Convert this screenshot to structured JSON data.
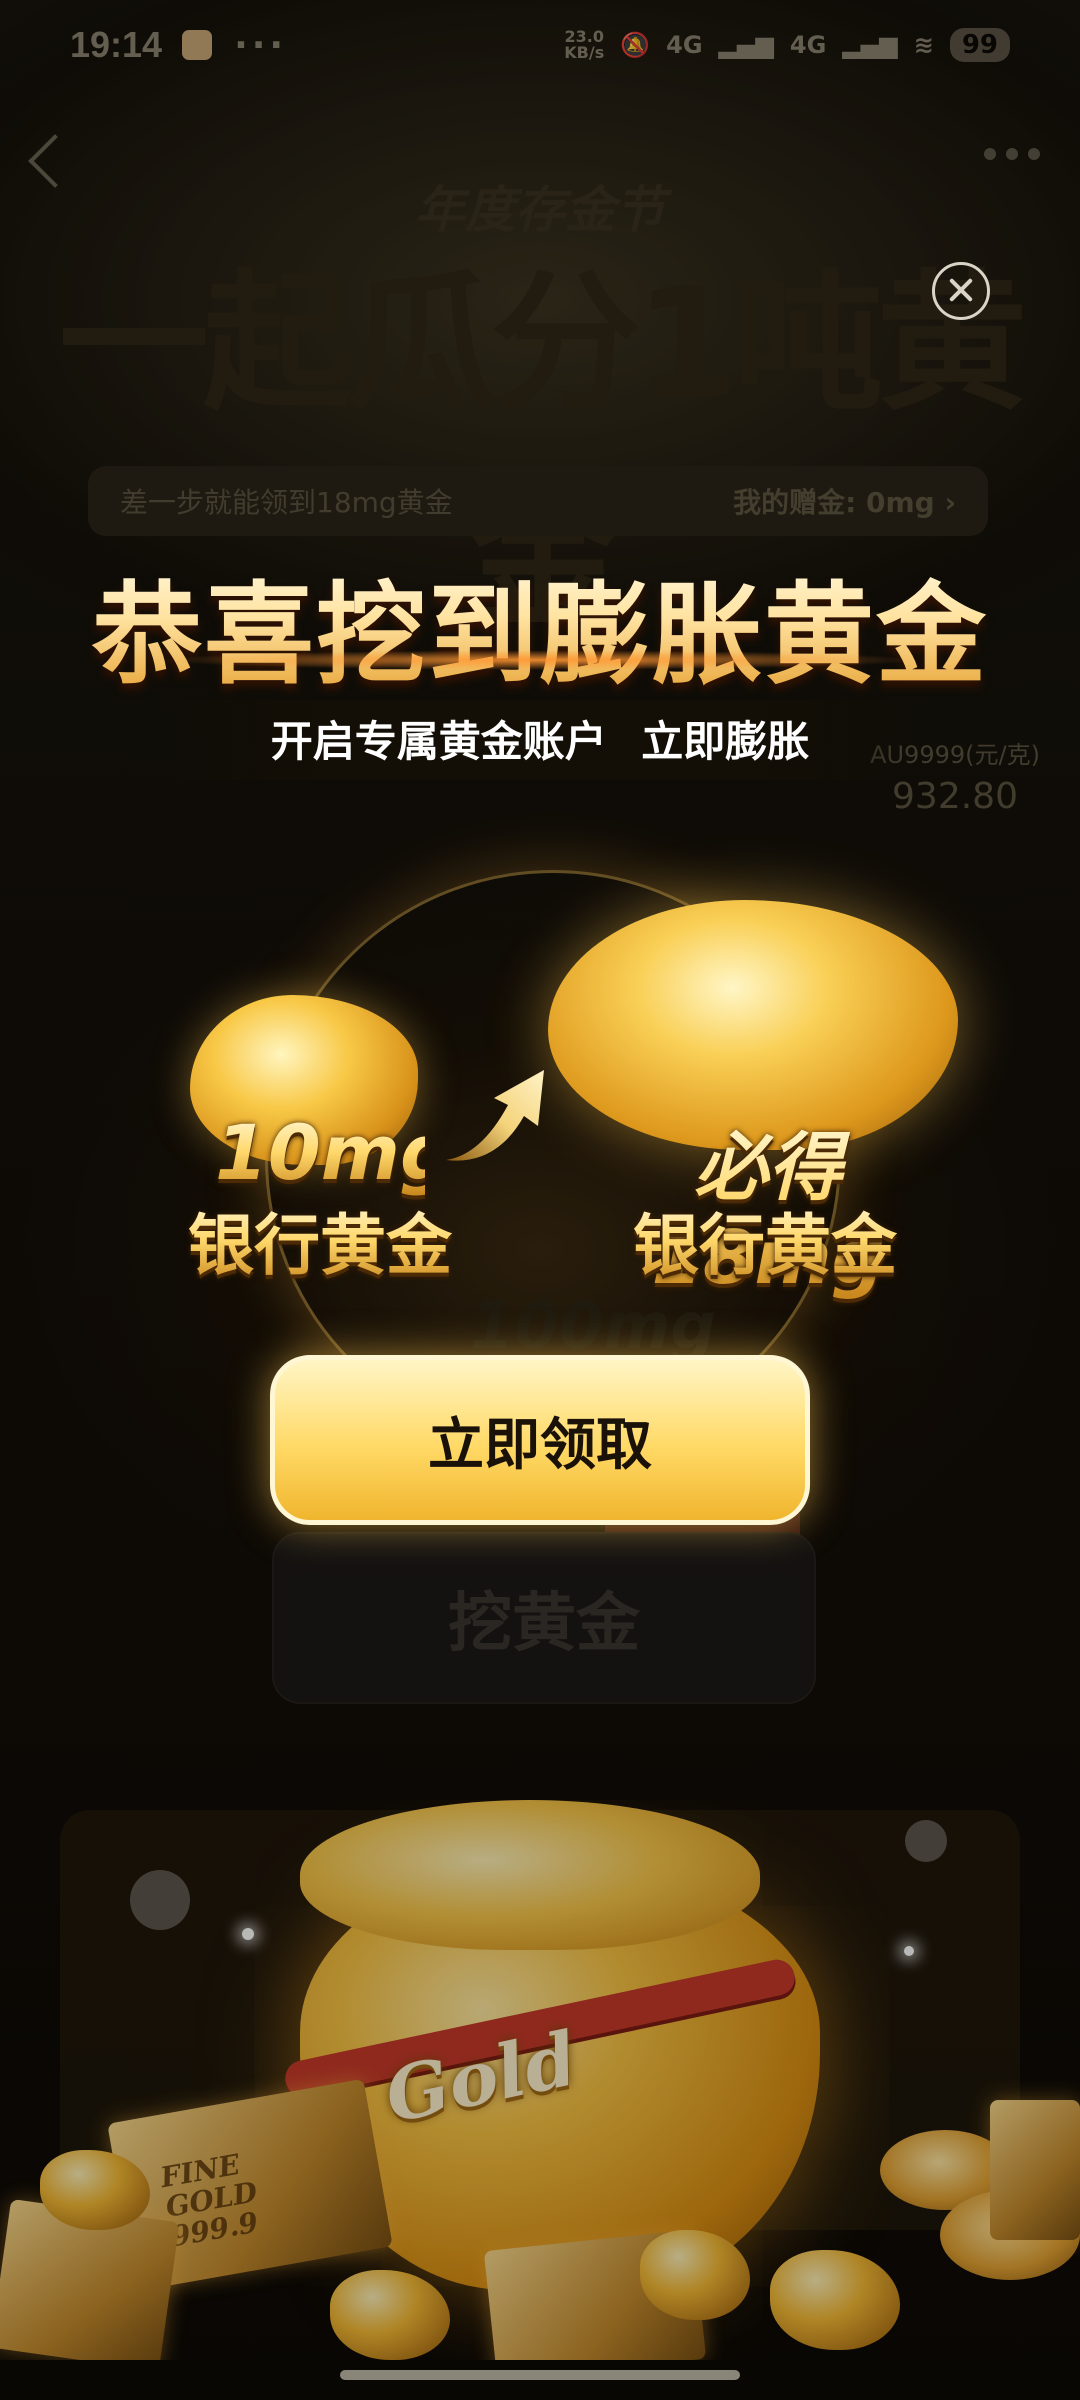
{
  "status_bar": {
    "time": "19:14",
    "more": "···",
    "net_speed_value": "23.0",
    "net_speed_unit": "KB/s",
    "signal_1": "4G",
    "signal_2": "4G",
    "battery": "99"
  },
  "background_page": {
    "subtitle": "年度存金节",
    "headline": "一起瓜分1吨黄金",
    "progress_text": "差一步就能领到18mg黄金",
    "my_gift": "我的赠金: 0mg ›",
    "price_label": "AU9999(元/克)",
    "price_value": "932.80",
    "mid_amount": "100mg",
    "dig_button": "挖黄金"
  },
  "popup": {
    "title": "恭喜挖到膨胀黄金",
    "subtitle": "开启专属黄金账户   立即膨胀",
    "small_reward_amount": "10mg",
    "small_reward_label": "银行黄金",
    "large_reward_amount": "必得18mg",
    "large_reward_label": "银行黄金",
    "claim_button": "立即领取",
    "close_icon": "close-icon",
    "arrow_icon": "arrow-up-right-icon"
  },
  "illustration": {
    "bag_text": "Gold",
    "bar_text": "FINE GOLD 999.9"
  },
  "colors": {
    "gold_light": "#fff1b8",
    "gold_dark": "#c7841a",
    "button_gradient_top": "#fff5c5",
    "button_gradient_bottom": "#f0b52e"
  }
}
